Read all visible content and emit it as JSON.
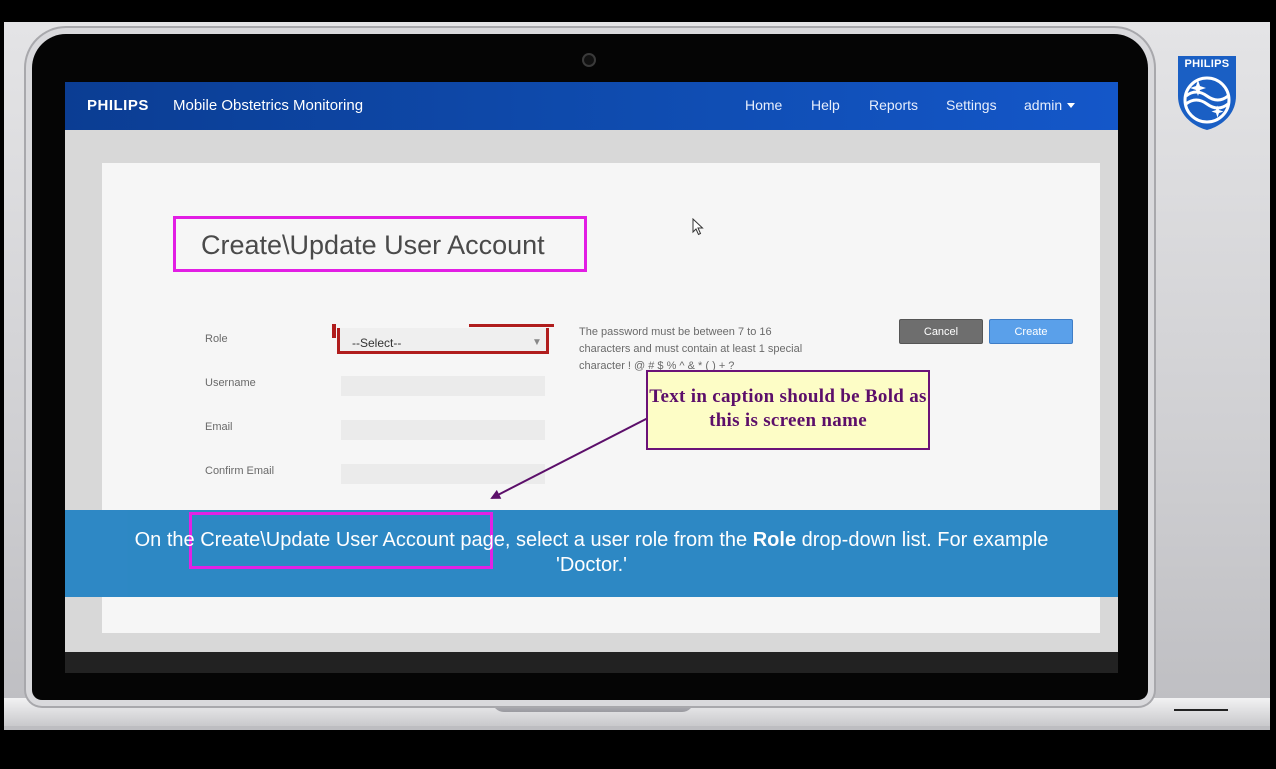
{
  "brand": {
    "logo_text": "PHILIPS",
    "product_name": "Mobile Obstetrics Monitoring",
    "emblem_text": "PHILIPS"
  },
  "nav": {
    "items": [
      {
        "label": "Home"
      },
      {
        "label": "Help"
      },
      {
        "label": "Reports"
      },
      {
        "label": "Settings"
      },
      {
        "label": "admin"
      }
    ]
  },
  "page": {
    "title": "Create\\Update User Account"
  },
  "form": {
    "role_label": "Role",
    "role_value": "--Select--",
    "username_label": "Username",
    "email_label": "Email",
    "confirm_email_label": "Confirm Email",
    "password_hint": "The password must be between 7 to 16 characters and must contain at least 1 special character ! @ # $ % ^ & * ( ) + ?"
  },
  "buttons": {
    "cancel": "Cancel",
    "create": "Create"
  },
  "caption": {
    "prefix": "On the ",
    "highlight": "Create\\Update User Account",
    "middle": " page, select a user role from the ",
    "bold": "Role",
    "suffix": " drop-down list. For example 'Doctor.'"
  },
  "annotation": {
    "text": "Text in caption should be Bold as this is screen name"
  },
  "colors": {
    "navbar": "#0f4cb0",
    "caption_bar": "#2a86c4",
    "highlight_border": "#e21ee4",
    "select_highlight": "#b01d1d",
    "callout_bg": "#fdfdc6",
    "callout_text": "#5c0f6a"
  }
}
